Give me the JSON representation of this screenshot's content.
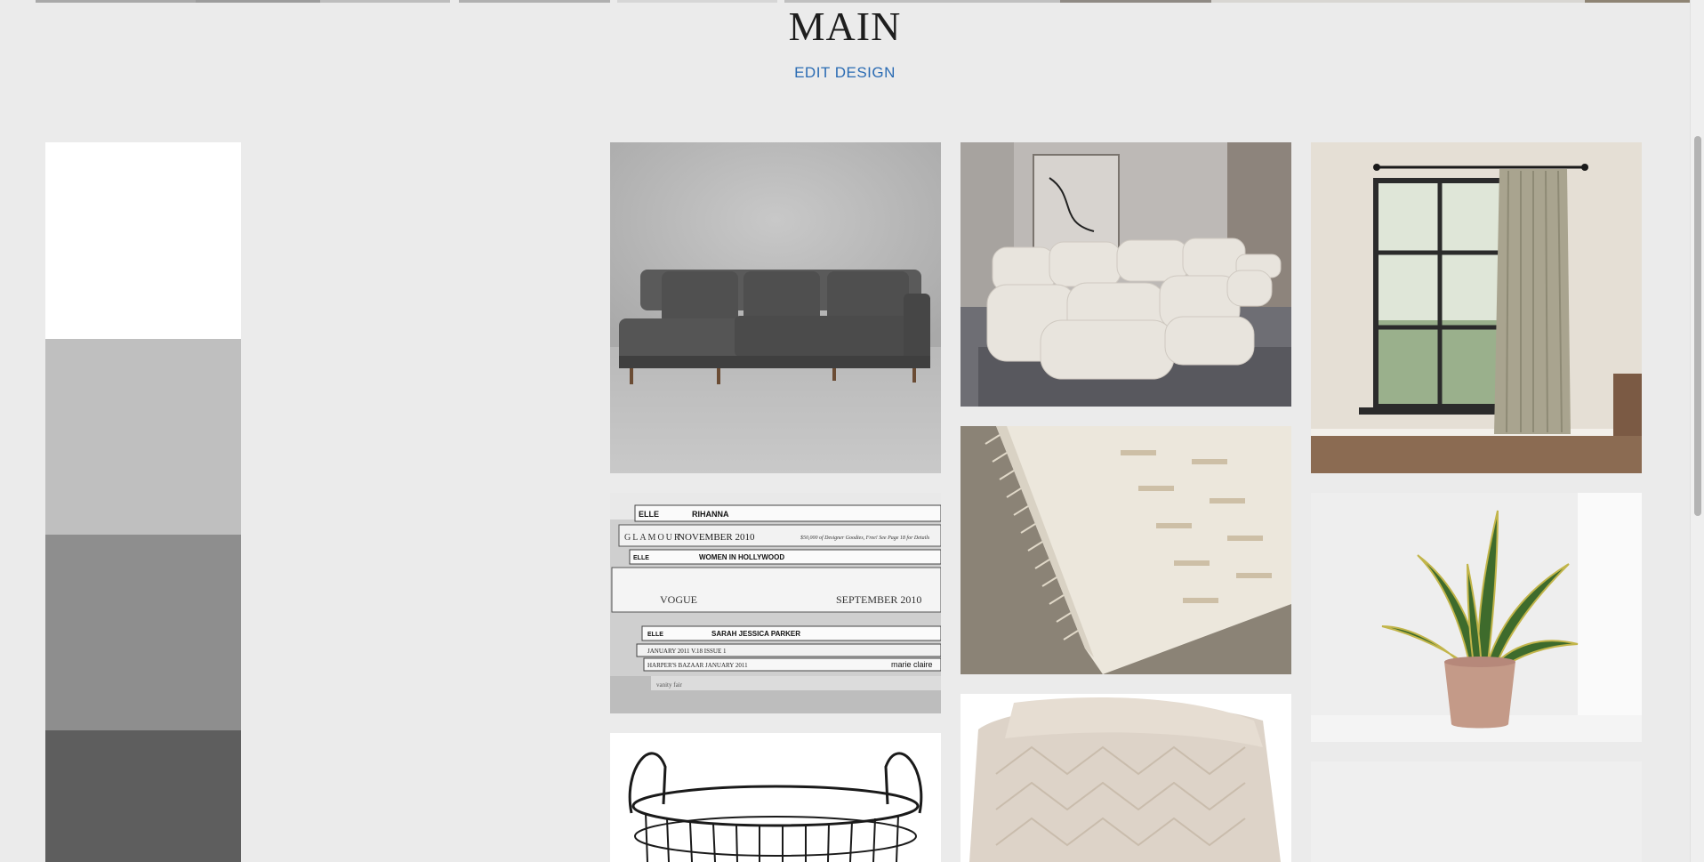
{
  "page": {
    "title": "MAIN",
    "edit_link_label": "EDIT DESIGN"
  },
  "palette": {
    "swatches": [
      "#ffffff",
      "#bfbfbf",
      "#8e8e8e",
      "#5e5e5e"
    ]
  },
  "images": [
    {
      "name": "sofa-sectional-image",
      "description": "Dark grey velvet sectional sofa"
    },
    {
      "name": "magazine-stack-image",
      "description": "Stack of fashion magazines"
    },
    {
      "name": "wire-basket-image",
      "description": "Black wire basket with handles"
    },
    {
      "name": "modular-sofa-image",
      "description": "Cream modular tufted sofa"
    },
    {
      "name": "woven-rug-image",
      "description": "Cream textured rug with fringe"
    },
    {
      "name": "knit-throw-image",
      "description": "Folded cream knit throw blanket"
    },
    {
      "name": "curtain-window-image",
      "description": "Linen curtain beside window"
    },
    {
      "name": "snake-plant-image",
      "description": "Snake plant in pink pot"
    },
    {
      "name": "blank-tile-image",
      "description": "Light placeholder tile"
    }
  ],
  "magazine_text": {
    "line1_brand": "ELLE",
    "line1_text": "RIHANNA",
    "line2_brand": "GLAMOUR",
    "line2_date": "NOVEMBER 2010",
    "line2_tag": "$50,000 of Designer Goodies, Free! See Page 18 for Details",
    "line3_brand": "ELLE",
    "line3_text": "WOMEN IN HOLLYWOOD",
    "line4_brand": "VOGUE",
    "line4_date": "SEPTEMBER 2010",
    "line5_brand": "ELLE",
    "line5_text": "SARAH JESSICA PARKER",
    "line6_text": "JANUARY 2011  V.18  ISSUE 1",
    "line7_text": "HARPER'S BAZAAR JANUARY 2011",
    "line7_brand": "marie claire",
    "line8_text": "vanity fair"
  }
}
